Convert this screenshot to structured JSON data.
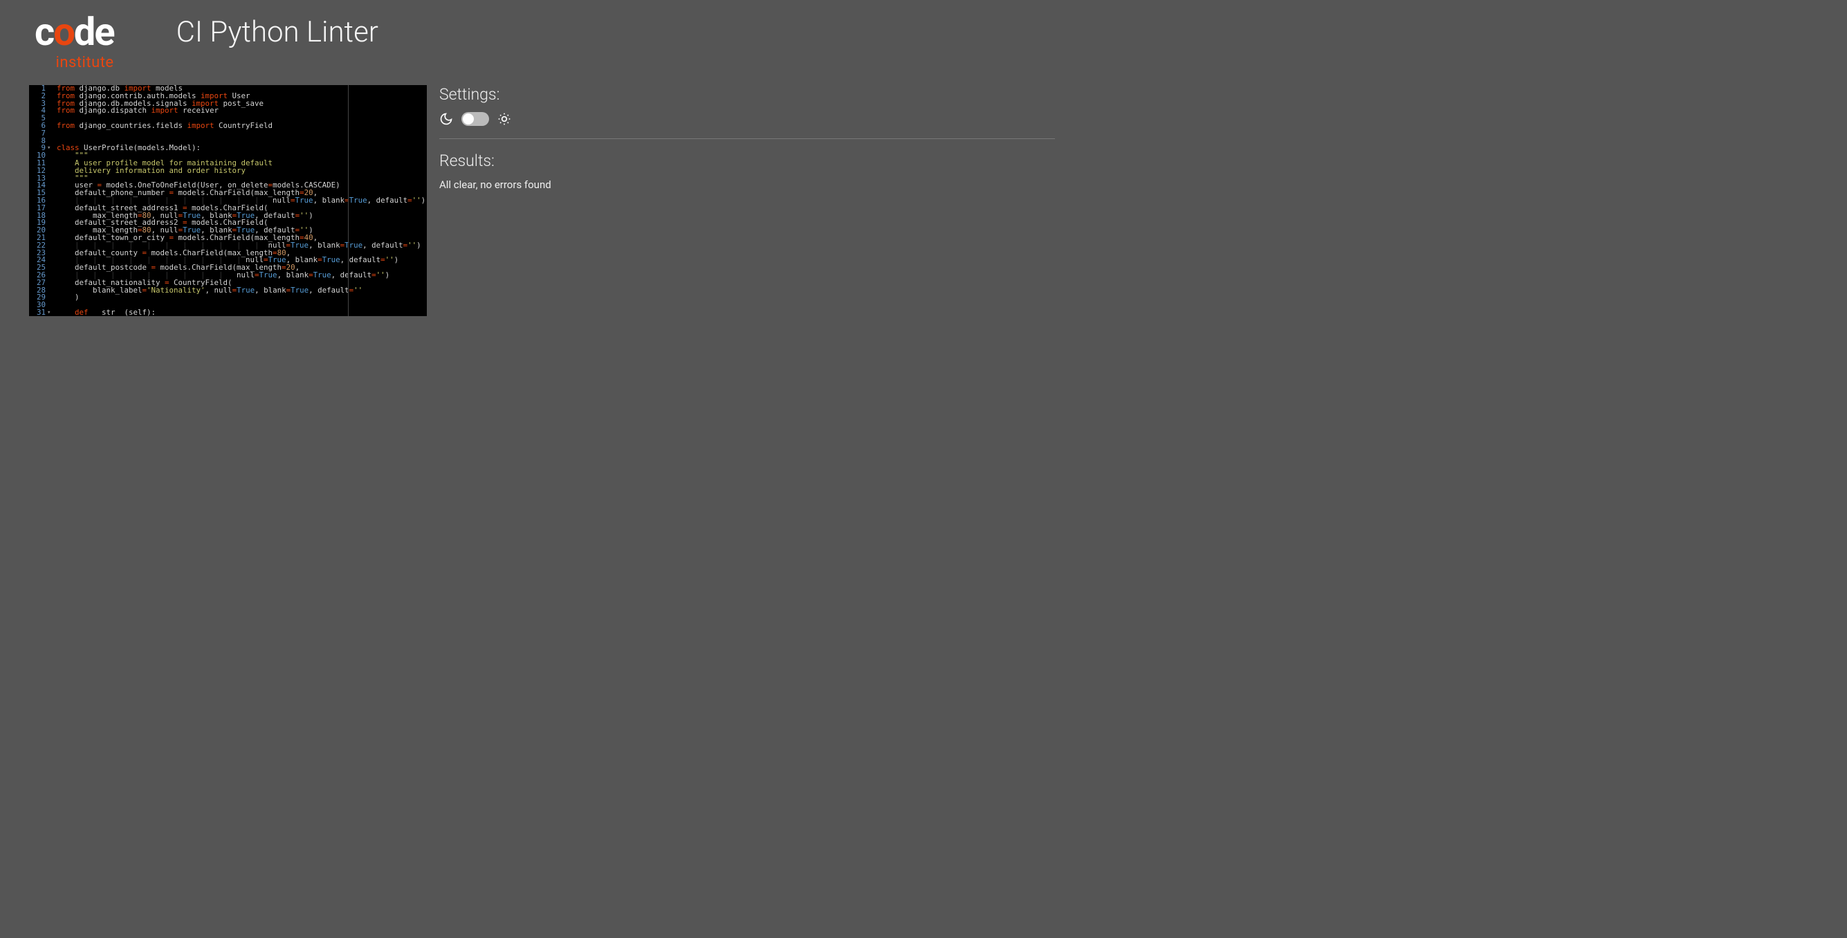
{
  "logo": {
    "part1": "c",
    "part2": "o",
    "part3": "de",
    "sub": "institute"
  },
  "title": "CI Python Linter",
  "sidebar": {
    "settings_label": "Settings:",
    "results_label": "Results:",
    "results_text": "All clear, no errors found",
    "theme_toggle_state": "dark"
  },
  "editor": {
    "lines": [
      {
        "n": 1,
        "tokens": [
          [
            "kw",
            "from"
          ],
          [
            "def",
            " django.db "
          ],
          [
            "kw",
            "import"
          ],
          [
            "def",
            " models"
          ]
        ]
      },
      {
        "n": 2,
        "tokens": [
          [
            "kw",
            "from"
          ],
          [
            "def",
            " django.contrib.auth.models "
          ],
          [
            "kw",
            "import"
          ],
          [
            "def",
            " User"
          ]
        ]
      },
      {
        "n": 3,
        "tokens": [
          [
            "kw",
            "from"
          ],
          [
            "def",
            " django.db.models.signals "
          ],
          [
            "kw",
            "import"
          ],
          [
            "def",
            " post_save"
          ]
        ]
      },
      {
        "n": 4,
        "tokens": [
          [
            "kw",
            "from"
          ],
          [
            "def",
            " django.dispatch "
          ],
          [
            "kw",
            "import"
          ],
          [
            "def",
            " receiver"
          ]
        ]
      },
      {
        "n": 5,
        "tokens": []
      },
      {
        "n": 6,
        "tokens": [
          [
            "kw",
            "from"
          ],
          [
            "def",
            " django_countries.fields "
          ],
          [
            "kw",
            "import"
          ],
          [
            "def",
            " CountryField"
          ]
        ]
      },
      {
        "n": 7,
        "tokens": []
      },
      {
        "n": 8,
        "tokens": []
      },
      {
        "n": 9,
        "fold": true,
        "tokens": [
          [
            "kw",
            "class"
          ],
          [
            "def",
            " UserProfile(models.Model):"
          ]
        ]
      },
      {
        "n": 10,
        "tokens": [
          [
            "def",
            "    "
          ],
          [
            "str",
            "\"\"\""
          ]
        ]
      },
      {
        "n": 11,
        "tokens": [
          [
            "def",
            "    "
          ],
          [
            "str",
            "A user profile model for maintaining default"
          ]
        ]
      },
      {
        "n": 12,
        "tokens": [
          [
            "def",
            "    "
          ],
          [
            "str",
            "delivery information and order history"
          ]
        ]
      },
      {
        "n": 13,
        "tokens": [
          [
            "def",
            "    "
          ],
          [
            "str",
            "\"\"\""
          ]
        ]
      },
      {
        "n": 14,
        "tokens": [
          [
            "def",
            "    user "
          ],
          [
            "op",
            "="
          ],
          [
            "def",
            " models.OneToOneField(User, on_delete"
          ],
          [
            "op",
            "="
          ],
          [
            "def",
            "models.CASCADE)"
          ]
        ]
      },
      {
        "n": 15,
        "tokens": [
          [
            "def",
            "    default_phone_number "
          ],
          [
            "op",
            "="
          ],
          [
            "def",
            " models.CharField(max_length"
          ],
          [
            "op",
            "="
          ],
          [
            "num",
            "20"
          ],
          [
            "def",
            ","
          ]
        ]
      },
      {
        "n": 16,
        "tokens": [
          [
            "indent-guide",
            "    |   |   |   |   |   |   |   |   |   |   |   "
          ],
          [
            "def",
            "null"
          ],
          [
            "op",
            "="
          ],
          [
            "const",
            "True"
          ],
          [
            "def",
            ", blank"
          ],
          [
            "op",
            "="
          ],
          [
            "const",
            "True"
          ],
          [
            "def",
            ", default"
          ],
          [
            "op",
            "="
          ],
          [
            "str",
            "''"
          ],
          [
            "def",
            ")"
          ]
        ]
      },
      {
        "n": 17,
        "tokens": [
          [
            "def",
            "    default_street_address1 "
          ],
          [
            "op",
            "="
          ],
          [
            "def",
            " models.CharField("
          ]
        ]
      },
      {
        "n": 18,
        "tokens": [
          [
            "def",
            "        max_length"
          ],
          [
            "op",
            "="
          ],
          [
            "num",
            "80"
          ],
          [
            "def",
            ", null"
          ],
          [
            "op",
            "="
          ],
          [
            "const",
            "True"
          ],
          [
            "def",
            ", blank"
          ],
          [
            "op",
            "="
          ],
          [
            "const",
            "True"
          ],
          [
            "def",
            ", default"
          ],
          [
            "op",
            "="
          ],
          [
            "str",
            "''"
          ],
          [
            "def",
            ")"
          ]
        ]
      },
      {
        "n": 19,
        "tokens": [
          [
            "def",
            "    default_street_address2 "
          ],
          [
            "op",
            "="
          ],
          [
            "def",
            " models.CharField("
          ]
        ]
      },
      {
        "n": 20,
        "tokens": [
          [
            "def",
            "        max_length"
          ],
          [
            "op",
            "="
          ],
          [
            "num",
            "80"
          ],
          [
            "def",
            ", null"
          ],
          [
            "op",
            "="
          ],
          [
            "const",
            "True"
          ],
          [
            "def",
            ", blank"
          ],
          [
            "op",
            "="
          ],
          [
            "const",
            "True"
          ],
          [
            "def",
            ", default"
          ],
          [
            "op",
            "="
          ],
          [
            "str",
            "''"
          ],
          [
            "def",
            ")"
          ]
        ]
      },
      {
        "n": 21,
        "tokens": [
          [
            "def",
            "    default_town_or_city "
          ],
          [
            "op",
            "="
          ],
          [
            "def",
            " models.CharField(max_length"
          ],
          [
            "op",
            "="
          ],
          [
            "num",
            "40"
          ],
          [
            "def",
            ","
          ]
        ]
      },
      {
        "n": 22,
        "tokens": [
          [
            "indent-guide",
            "    |   |   |   |   |   |   |   |   |   |   |  "
          ],
          [
            "def",
            "null"
          ],
          [
            "op",
            "="
          ],
          [
            "const",
            "True"
          ],
          [
            "def",
            ", blank"
          ],
          [
            "op",
            "="
          ],
          [
            "const",
            "True"
          ],
          [
            "def",
            ", default"
          ],
          [
            "op",
            "="
          ],
          [
            "str",
            "''"
          ],
          [
            "def",
            ")"
          ]
        ]
      },
      {
        "n": 23,
        "tokens": [
          [
            "def",
            "    default_county "
          ],
          [
            "op",
            "="
          ],
          [
            "def",
            " models.CharField(max_length"
          ],
          [
            "op",
            "="
          ],
          [
            "num",
            "80"
          ],
          [
            "def",
            ","
          ]
        ]
      },
      {
        "n": 24,
        "tokens": [
          [
            "indent-guide",
            "    |   |   |   |   |   |   |   |   |   | "
          ],
          [
            "def",
            "null"
          ],
          [
            "op",
            "="
          ],
          [
            "const",
            "True"
          ],
          [
            "def",
            ", blank"
          ],
          [
            "op",
            "="
          ],
          [
            "const",
            "True"
          ],
          [
            "def",
            ", default"
          ],
          [
            "op",
            "="
          ],
          [
            "str",
            "''"
          ],
          [
            "def",
            ")"
          ]
        ]
      },
      {
        "n": 25,
        "tokens": [
          [
            "def",
            "    default_postcode "
          ],
          [
            "op",
            "="
          ],
          [
            "def",
            " models.CharField(max_length"
          ],
          [
            "op",
            "="
          ],
          [
            "num",
            "20"
          ],
          [
            "def",
            ","
          ]
        ]
      },
      {
        "n": 26,
        "tokens": [
          [
            "indent-guide",
            "    |   |   |   |   |   |   |   |   |   "
          ],
          [
            "def",
            "null"
          ],
          [
            "op",
            "="
          ],
          [
            "const",
            "True"
          ],
          [
            "def",
            ", blank"
          ],
          [
            "op",
            "="
          ],
          [
            "const",
            "True"
          ],
          [
            "def",
            ", default"
          ],
          [
            "op",
            "="
          ],
          [
            "str",
            "''"
          ],
          [
            "def",
            ")"
          ]
        ]
      },
      {
        "n": 27,
        "tokens": [
          [
            "def",
            "    default_nationality "
          ],
          [
            "op",
            "="
          ],
          [
            "def",
            " CountryField("
          ]
        ]
      },
      {
        "n": 28,
        "tokens": [
          [
            "def",
            "        blank_label"
          ],
          [
            "op",
            "="
          ],
          [
            "str",
            "'Nationality'"
          ],
          [
            "def",
            ", null"
          ],
          [
            "op",
            "="
          ],
          [
            "const",
            "True"
          ],
          [
            "def",
            ", blank"
          ],
          [
            "op",
            "="
          ],
          [
            "const",
            "True"
          ],
          [
            "def",
            ", default"
          ],
          [
            "op",
            "="
          ],
          [
            "str",
            "''"
          ]
        ]
      },
      {
        "n": 29,
        "tokens": [
          [
            "def",
            "    )"
          ]
        ]
      },
      {
        "n": 30,
        "tokens": []
      },
      {
        "n": 31,
        "fold": true,
        "tokens": [
          [
            "def",
            "    "
          ],
          [
            "kw",
            "def"
          ],
          [
            "def",
            " __str__(self):"
          ]
        ]
      }
    ]
  }
}
